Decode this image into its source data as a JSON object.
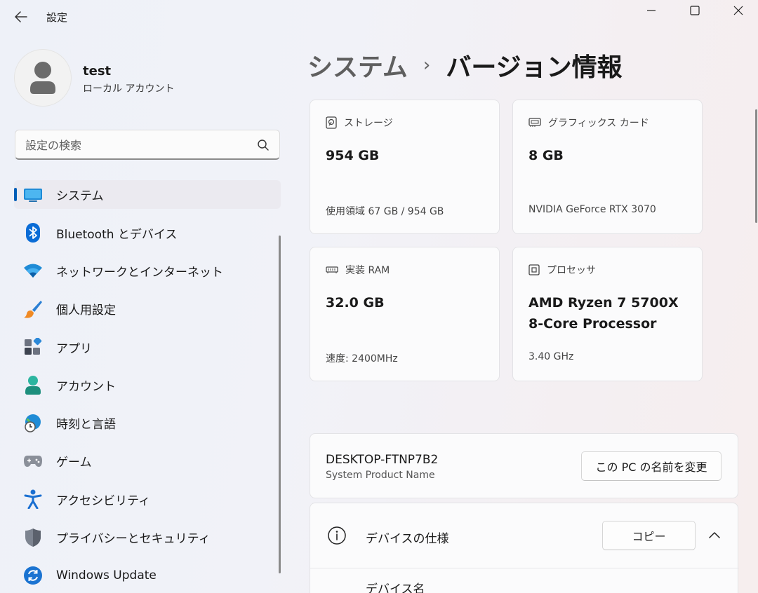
{
  "window": {
    "title": "設定"
  },
  "user": {
    "name": "test",
    "account_type": "ローカル アカウント"
  },
  "search": {
    "placeholder": "設定の検索"
  },
  "nav": {
    "items": [
      {
        "label": "システム",
        "icon": "system-icon",
        "selected": true
      },
      {
        "label": "Bluetooth とデバイス",
        "icon": "bluetooth-icon"
      },
      {
        "label": "ネットワークとインターネット",
        "icon": "wifi-icon"
      },
      {
        "label": "個人用設定",
        "icon": "brush-icon"
      },
      {
        "label": "アプリ",
        "icon": "apps-icon"
      },
      {
        "label": "アカウント",
        "icon": "account-icon"
      },
      {
        "label": "時刻と言語",
        "icon": "globe-clock-icon"
      },
      {
        "label": "ゲーム",
        "icon": "gamepad-icon"
      },
      {
        "label": "アクセシビリティ",
        "icon": "accessibility-icon"
      },
      {
        "label": "プライバシーとセキュリティ",
        "icon": "shield-icon"
      },
      {
        "label": "Windows Update",
        "icon": "update-icon"
      }
    ]
  },
  "breadcrumb": {
    "parent": "システム",
    "separator": "›",
    "current": "バージョン情報"
  },
  "cards": {
    "storage": {
      "title": "ストレージ",
      "value": "954 GB",
      "sub": "使用領域 67 GB / 954 GB"
    },
    "graphics": {
      "title": "グラフィックス カード",
      "value": "8 GB",
      "sub": "NVIDIA GeForce RTX 3070"
    },
    "ram": {
      "title": "実装 RAM",
      "value": "32.0 GB",
      "sub": "速度: 2400MHz"
    },
    "processor": {
      "title": "プロセッサ",
      "value_line1": "AMD Ryzen 7 5700X",
      "value_line2": "8-Core Processor",
      "sub": "3.40 GHz"
    }
  },
  "device": {
    "name": "DESKTOP-FTNP7B2",
    "model": "System Product Name",
    "rename_label": "この PC の名前を変更"
  },
  "specs": {
    "title": "デバイスの仕様",
    "copy_label": "コピー",
    "first_row_label": "デバイス名"
  },
  "colors": {
    "accent": "#005fb8"
  }
}
